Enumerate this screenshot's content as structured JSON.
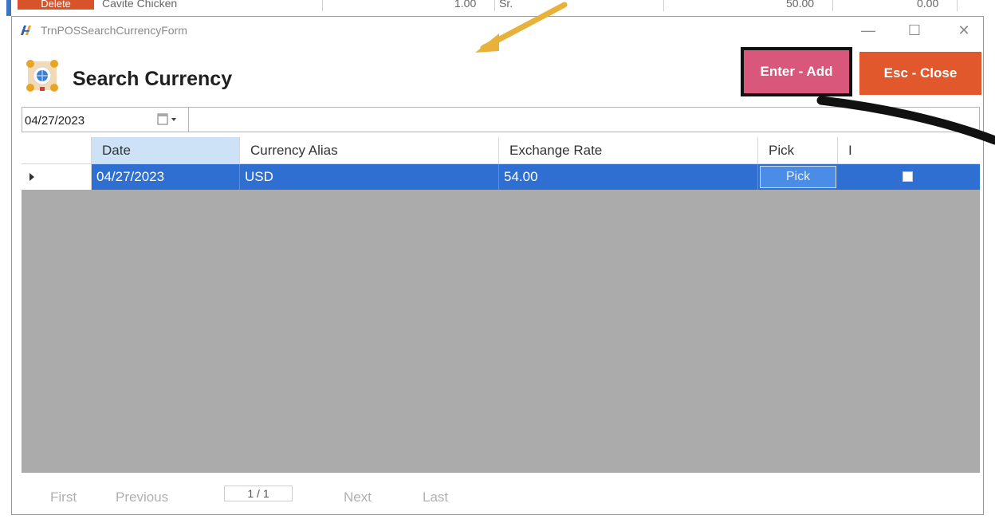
{
  "background_window": {
    "delete_label": "Delete",
    "item_name": "Cavite Chicken",
    "qty": "1.00",
    "extra": "Sr.",
    "price": "50.00",
    "discount": "0.00"
  },
  "window": {
    "title": "TrnPOSSearchCurrencyForm",
    "minimize_glyph": "—",
    "maximize_glyph": "☐",
    "close_glyph": "✕"
  },
  "header": {
    "title": "Search Currency",
    "add_button": "Enter - Add",
    "close_button": "Esc - Close"
  },
  "filter": {
    "date": "04/27/2023"
  },
  "grid": {
    "columns": [
      "Date",
      "Currency Alias",
      "Exchange Rate",
      "Pick",
      "I"
    ],
    "rows": [
      {
        "date": "04/27/2023",
        "currency_alias": "USD",
        "exchange_rate": "54.00",
        "pick": "Pick",
        "checked": false
      }
    ]
  },
  "pager": {
    "first": "First",
    "previous": "Previous",
    "page": "1 / 1",
    "next": "Next",
    "last": "Last"
  },
  "colors": {
    "selected_row": "#2f6fd1",
    "add_button": "#d9577a",
    "close_button": "#e0582b",
    "annotation_arrow": "#e8b23a"
  }
}
